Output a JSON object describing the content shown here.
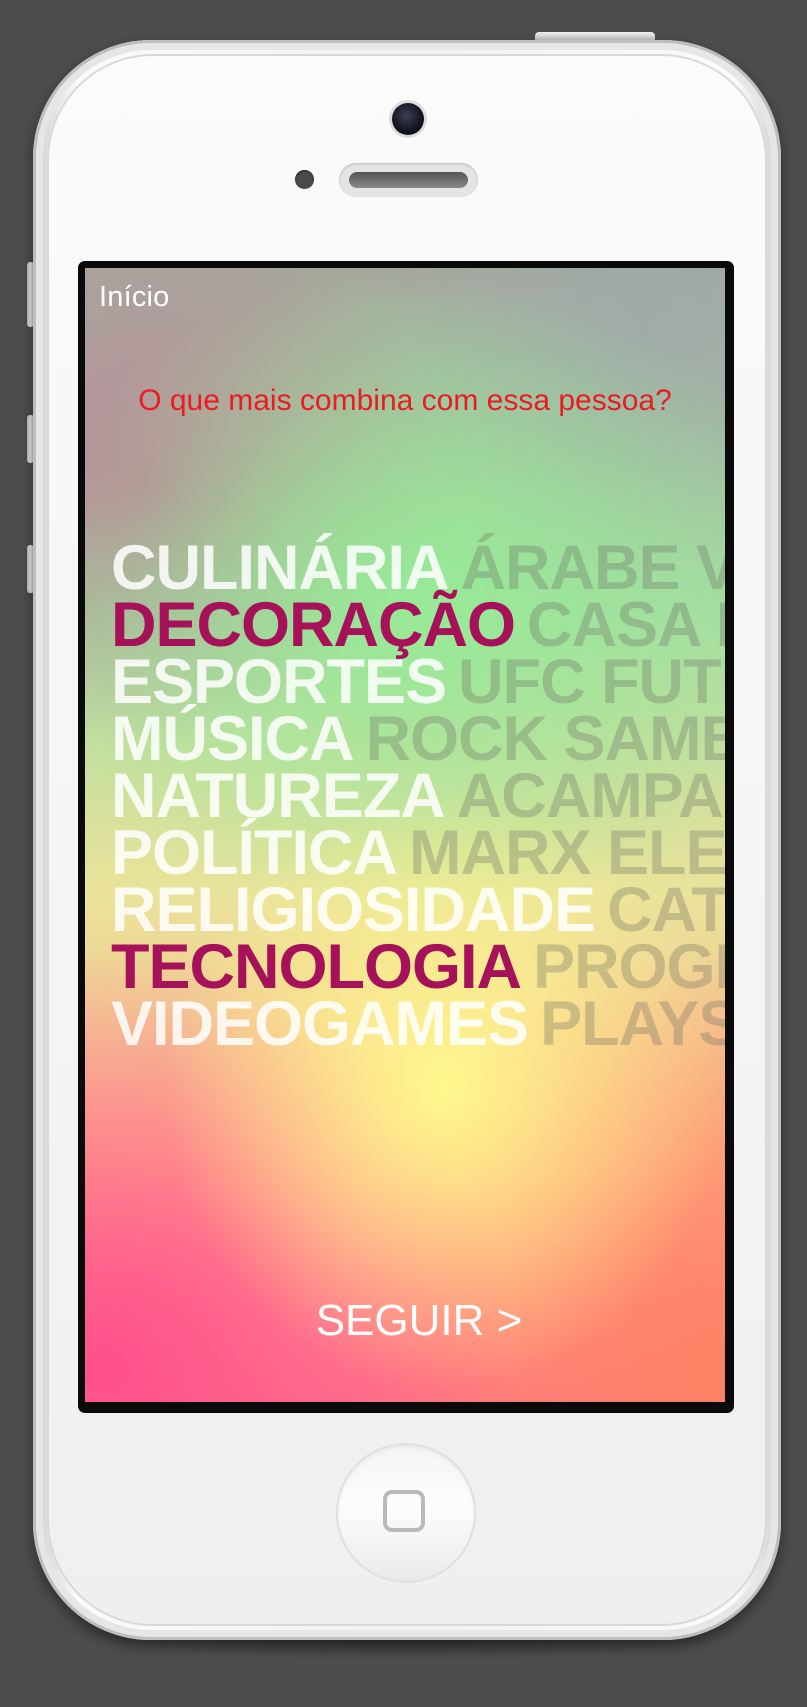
{
  "header": {
    "title": "Início"
  },
  "question": "O que mais combina com essa pessoa?",
  "categories": [
    {
      "label": "CULINÁRIA",
      "subtags": "ÁRABE V",
      "selected": false
    },
    {
      "label": "DECORAÇÃO",
      "subtags": "CASA E",
      "selected": true
    },
    {
      "label": "ESPORTES",
      "subtags": "UFC FUTE",
      "selected": false
    },
    {
      "label": "MÚSICA",
      "subtags": "ROCK SAMB",
      "selected": false
    },
    {
      "label": "NATUREZA",
      "subtags": "ACAMPA",
      "selected": false
    },
    {
      "label": "POLÍTICA",
      "subtags": "MARX ELEI",
      "selected": false
    },
    {
      "label": "RELIGIOSIDADE",
      "subtags": "CAT",
      "selected": false
    },
    {
      "label": "TECNOLOGIA",
      "subtags": "PROGR",
      "selected": true
    },
    {
      "label": "VIDEOGAMES",
      "subtags": "PLAYS",
      "selected": false
    }
  ],
  "footer": {
    "next_label": "SEGUIR >"
  },
  "colors": {
    "question": "#ea1b23",
    "selected_tag": "#a6125a",
    "unselected_tag": "#ffffff",
    "background": "#4d4d4d"
  },
  "icons": {
    "home_button": "home-square-icon",
    "camera": "front-camera-icon",
    "speaker": "earpiece-icon"
  }
}
